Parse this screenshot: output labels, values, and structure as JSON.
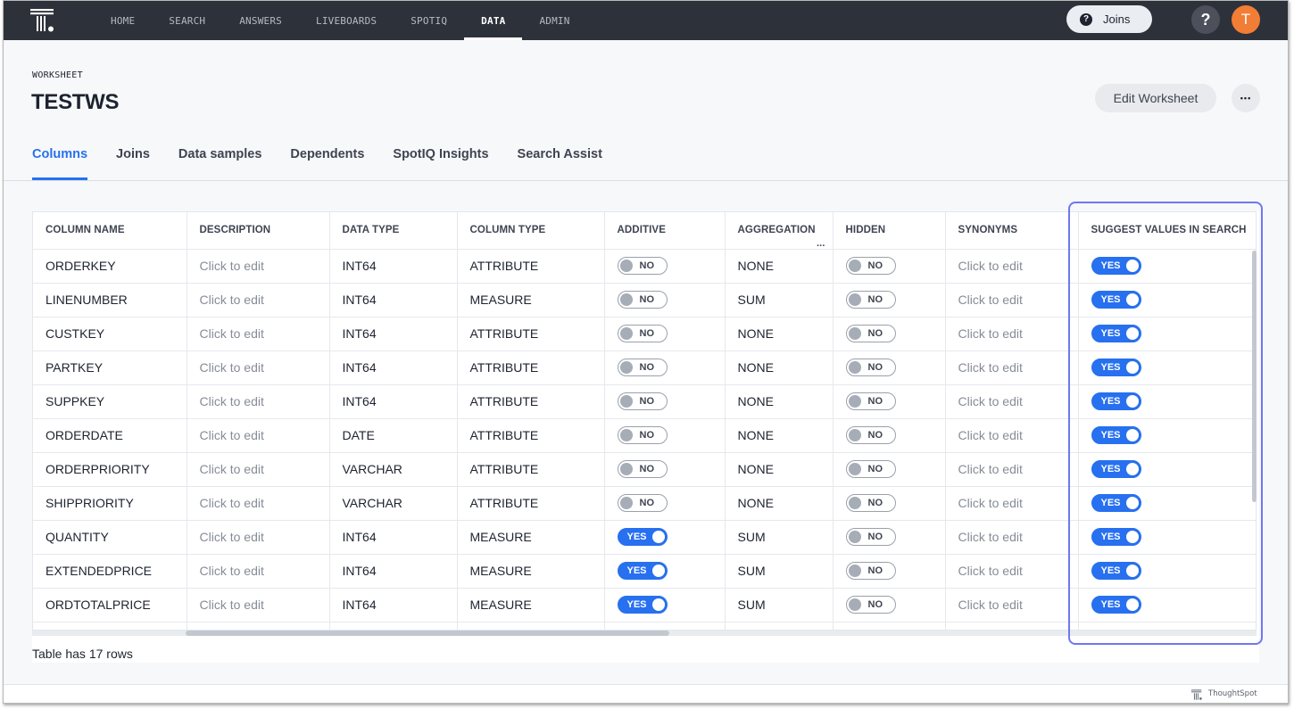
{
  "nav": {
    "items": [
      {
        "label": "HOME",
        "active": false
      },
      {
        "label": "SEARCH",
        "active": false
      },
      {
        "label": "ANSWERS",
        "active": false
      },
      {
        "label": "LIVEBOARDS",
        "active": false
      },
      {
        "label": "SPOTIQ",
        "active": false
      },
      {
        "label": "DATA",
        "active": true
      },
      {
        "label": "ADMIN",
        "active": false
      }
    ],
    "joins_pill": "Joins",
    "help_label": "?",
    "avatar_initial": "T"
  },
  "header": {
    "kicker": "WORKSHEET",
    "title": "TESTWS",
    "edit_button": "Edit Worksheet",
    "more_button": "•••"
  },
  "tabs": [
    {
      "label": "Columns",
      "active": true
    },
    {
      "label": "Joins",
      "active": false
    },
    {
      "label": "Data samples",
      "active": false
    },
    {
      "label": "Dependents",
      "active": false
    },
    {
      "label": "SpotIQ Insights",
      "active": false
    },
    {
      "label": "Search Assist",
      "active": false
    }
  ],
  "table": {
    "columns": [
      "COLUMN NAME",
      "DESCRIPTION",
      "DATA TYPE",
      "COLUMN TYPE",
      "ADDITIVE",
      "AGGREGATION",
      "HIDDEN",
      "SYNONYMS",
      "SUGGEST VALUES IN SEARCH"
    ],
    "aggregation_more": "...",
    "toggle_on_label": "YES",
    "toggle_off_label": "NO",
    "rows": [
      {
        "name": "ORDERKEY",
        "description": "Click to edit",
        "data_type": "INT64",
        "column_type": "ATTRIBUTE",
        "additive": false,
        "aggregation": "NONE",
        "hidden": false,
        "synonyms": "Click to edit",
        "suggest": true
      },
      {
        "name": "LINENUMBER",
        "description": "Click to edit",
        "data_type": "INT64",
        "column_type": "MEASURE",
        "additive": false,
        "aggregation": "SUM",
        "hidden": false,
        "synonyms": "Click to edit",
        "suggest": true
      },
      {
        "name": "CUSTKEY",
        "description": "Click to edit",
        "data_type": "INT64",
        "column_type": "ATTRIBUTE",
        "additive": false,
        "aggregation": "NONE",
        "hidden": false,
        "synonyms": "Click to edit",
        "suggest": true
      },
      {
        "name": "PARTKEY",
        "description": "Click to edit",
        "data_type": "INT64",
        "column_type": "ATTRIBUTE",
        "additive": false,
        "aggregation": "NONE",
        "hidden": false,
        "synonyms": "Click to edit",
        "suggest": true
      },
      {
        "name": "SUPPKEY",
        "description": "Click to edit",
        "data_type": "INT64",
        "column_type": "ATTRIBUTE",
        "additive": false,
        "aggregation": "NONE",
        "hidden": false,
        "synonyms": "Click to edit",
        "suggest": true
      },
      {
        "name": "ORDERDATE",
        "description": "Click to edit",
        "data_type": "DATE",
        "column_type": "ATTRIBUTE",
        "additive": false,
        "aggregation": "NONE",
        "hidden": false,
        "synonyms": "Click to edit",
        "suggest": true
      },
      {
        "name": "ORDERPRIORITY",
        "description": "Click to edit",
        "data_type": "VARCHAR",
        "column_type": "ATTRIBUTE",
        "additive": false,
        "aggregation": "NONE",
        "hidden": false,
        "synonyms": "Click to edit",
        "suggest": true
      },
      {
        "name": "SHIPPRIORITY",
        "description": "Click to edit",
        "data_type": "VARCHAR",
        "column_type": "ATTRIBUTE",
        "additive": false,
        "aggregation": "NONE",
        "hidden": false,
        "synonyms": "Click to edit",
        "suggest": true
      },
      {
        "name": "QUANTITY",
        "description": "Click to edit",
        "data_type": "INT64",
        "column_type": "MEASURE",
        "additive": true,
        "aggregation": "SUM",
        "hidden": false,
        "synonyms": "Click to edit",
        "suggest": true
      },
      {
        "name": "EXTENDEDPRICE",
        "description": "Click to edit",
        "data_type": "INT64",
        "column_type": "MEASURE",
        "additive": true,
        "aggregation": "SUM",
        "hidden": false,
        "synonyms": "Click to edit",
        "suggest": true
      },
      {
        "name": "ORDTOTALPRICE",
        "description": "Click to edit",
        "data_type": "INT64",
        "column_type": "MEASURE",
        "additive": true,
        "aggregation": "SUM",
        "hidden": false,
        "synonyms": "Click to edit",
        "suggest": true
      }
    ],
    "row_count_text": "Table has 17 rows"
  },
  "footer": {
    "brand": "ThoughtSpot"
  },
  "colors": {
    "nav_bg": "#2d313a",
    "accent": "#2770ef",
    "avatar": "#f27d35",
    "highlight": "#6f77f0"
  }
}
